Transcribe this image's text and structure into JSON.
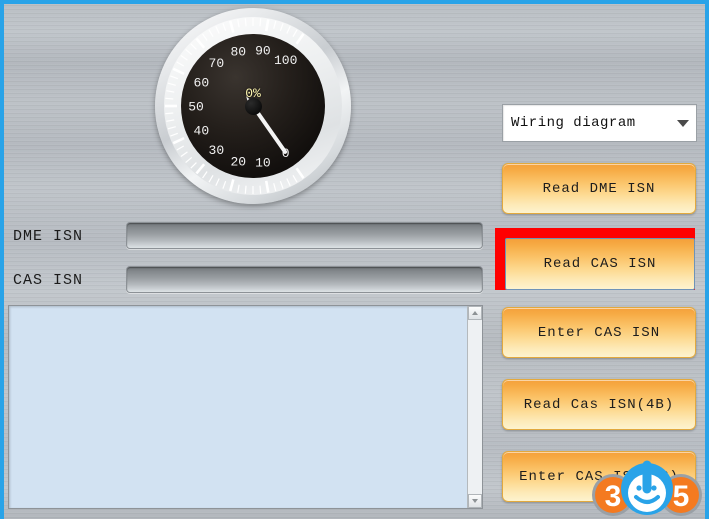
{
  "window": {
    "border_color": "#29a3e8",
    "background": "brushed-metal"
  },
  "gauge": {
    "name": "progress-gauge",
    "value_text": "0%",
    "value": 0,
    "min": 0,
    "max": 100,
    "tick_labels": [
      "0",
      "10",
      "20",
      "30",
      "40",
      "50",
      "60",
      "70",
      "80",
      "90",
      "100"
    ],
    "value_color": "#fff7b0",
    "face_color": "#19150f",
    "bezel_color": "#e9ebed"
  },
  "fields": [
    {
      "label": "DME ISN",
      "value": "",
      "name": "dme-isn"
    },
    {
      "label": "CAS ISN",
      "value": "",
      "name": "cas-isn"
    }
  ],
  "log": {
    "value": "",
    "background": "#d2e2f2"
  },
  "combo": {
    "selected": "Wiring diagram",
    "options": [
      "Wiring diagram"
    ]
  },
  "buttons": {
    "read_dme_isn": "Read DME ISN",
    "read_cas_isn": "Read CAS ISN",
    "enter_cas_isn": "Enter CAS ISN",
    "read_cas_isn_4b": "Read Cas ISN(4B)",
    "enter_cas_isn_4b": "Enter CAS ISN(4B)"
  },
  "highlight": {
    "target": "read_cas_isn",
    "color": "#ff0000"
  },
  "logo": {
    "text": "365",
    "digit1": "3",
    "digit3": "5",
    "orange": "#f47a20",
    "blue": "#29a3e8"
  }
}
